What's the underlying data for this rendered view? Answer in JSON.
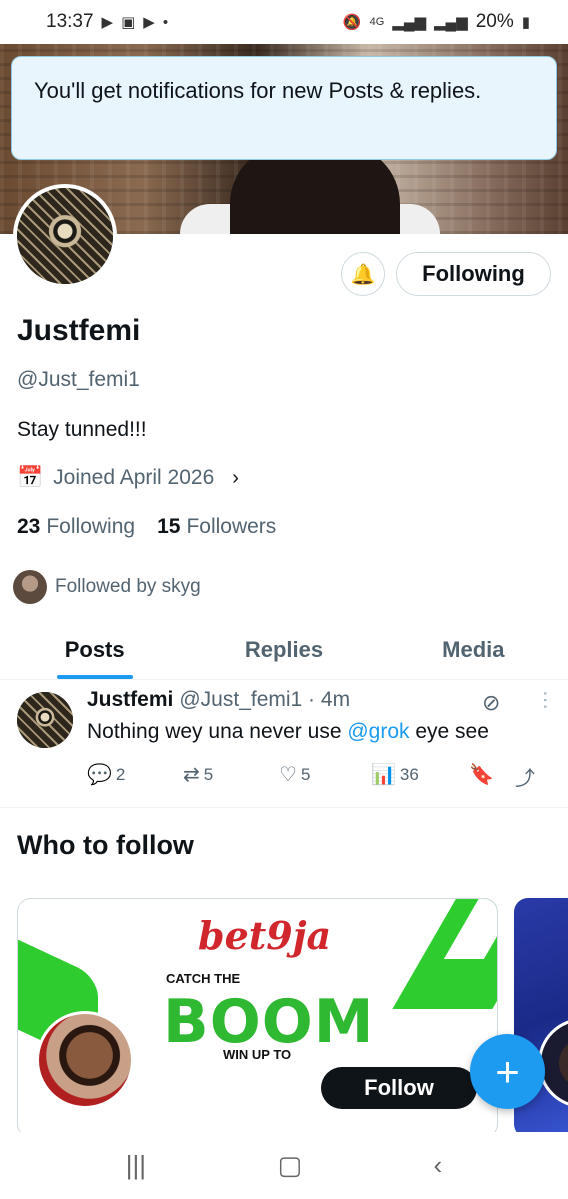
{
  "status_bar": {
    "time": "13:37",
    "left_icons": [
      "media-icon",
      "image-icon",
      "media-icon",
      "dot"
    ],
    "network": "4G",
    "battery": "20%"
  },
  "toast": {
    "message": "You'll get notifications for new Posts & replies."
  },
  "profile": {
    "display_name": "Justfemi",
    "handle": "@Just_femi1",
    "bio": "Stay tunned!!!",
    "joined": "Joined April 2026",
    "following_count": "23",
    "following_label": "Following",
    "followers_count": "15",
    "followers_label": "Followers",
    "followed_by": "Followed by skyg",
    "following_button": "Following"
  },
  "tabs": [
    {
      "label": "Posts",
      "active": true
    },
    {
      "label": "Replies",
      "active": false
    },
    {
      "label": "Media",
      "active": false
    }
  ],
  "post": {
    "name": "Justfemi",
    "meta": "@Just_femi1 · 4m",
    "text_before": "Nothing wey una never use ",
    "mention": "@grok",
    "text_after": " eye see",
    "replies": "2",
    "reposts": "5",
    "likes": "5",
    "views": "36"
  },
  "who_to_follow": {
    "title": "Who to follow",
    "card": {
      "brand": "bet9ja",
      "tagline_top": "CATCH THE",
      "tagline_main": "BOOM",
      "tagline_bottom": "WIN UP TO",
      "follow_button": "Follow"
    }
  },
  "colors": {
    "accent": "#1d9bf0",
    "text_primary": "#0f1419",
    "text_secondary": "#536471",
    "toast_bg": "#e8f5fd",
    "brand_red": "#d0262c",
    "brand_green": "#2fb832"
  },
  "fab": {
    "label": "+"
  },
  "nav": {
    "recent": "|||",
    "home": "▢",
    "back": "‹"
  }
}
